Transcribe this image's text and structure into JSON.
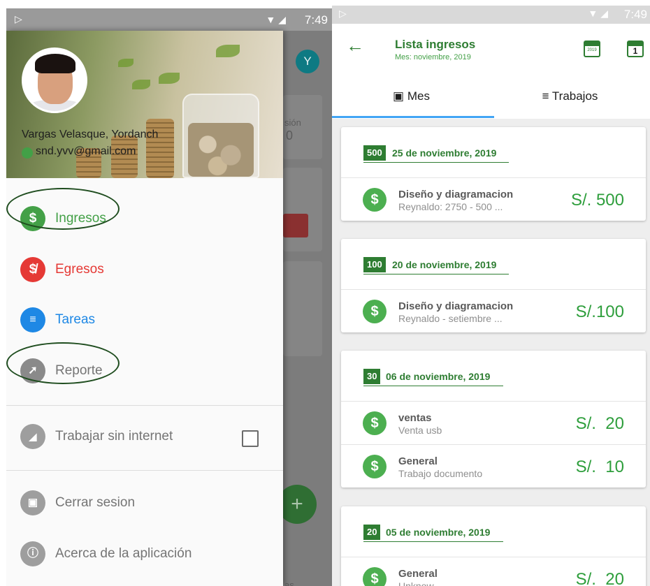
{
  "left_screen": {
    "status_bar": {
      "time": "7:49"
    },
    "background_app": {
      "avatar_letter": "Y",
      "text_fragment_1": "sión",
      "text_fragment_2": "0",
      "fab_symbol": "+",
      "bottom_fragment": "as"
    },
    "profile": {
      "name": "Vargas Velasque, Yordanch",
      "email": "snd.yvv@gmail.com"
    },
    "menu": {
      "ingresos": {
        "label": "Ingresos",
        "icon": "dollar-icon",
        "color": "#43a047"
      },
      "egresos": {
        "label": "Egresos",
        "icon": "no-dollar-icon",
        "color": "#e53935"
      },
      "tareas": {
        "label": "Tareas",
        "icon": "list-icon",
        "color": "#1e88e5"
      },
      "reporte": {
        "label": "Reporte",
        "icon": "trending-icon",
        "color": "#757575"
      },
      "offline": {
        "label": "Trabajar sin internet",
        "checked": false
      },
      "logout": {
        "label": "Cerrar sesion"
      },
      "about": {
        "label": "Acerca de la aplicación"
      }
    }
  },
  "right_screen": {
    "status_bar": {
      "time": "7:49"
    },
    "app_bar": {
      "title": "Lista ingresos",
      "subtitle": "Mes: noviembre, 2019",
      "year_icon_text": "2019",
      "day_icon_text": "1"
    },
    "tabs": [
      {
        "label": "Mes",
        "selected": true
      },
      {
        "label": "Trabajos",
        "selected": false
      }
    ],
    "accent_color": "#2e7d32",
    "indicator_color": "#42a5f5",
    "groups": [
      {
        "total": "500",
        "date": "25 de noviembre, 2019",
        "items": [
          {
            "title": "Diseño y diagramacion",
            "subtitle": "Reynaldo: 2750 - 500 ...",
            "amount": "S/. 500"
          }
        ]
      },
      {
        "total": "100",
        "date": "20 de noviembre, 2019",
        "items": [
          {
            "title": "Diseño y diagramacion",
            "subtitle": "Reynaldo - setiembre ...",
            "amount": "S/.100"
          }
        ]
      },
      {
        "total": "30",
        "date": "06 de noviembre, 2019",
        "items": [
          {
            "title": "ventas",
            "subtitle": "Venta usb",
            "amount": "S/.  20"
          },
          {
            "title": "General",
            "subtitle": "Trabajo documento",
            "amount": "S/.  10"
          }
        ]
      },
      {
        "total": "20",
        "date": "05 de noviembre, 2019",
        "items": [
          {
            "title": "General",
            "subtitle": "Unknow",
            "amount": "S/.  20"
          }
        ]
      }
    ]
  }
}
